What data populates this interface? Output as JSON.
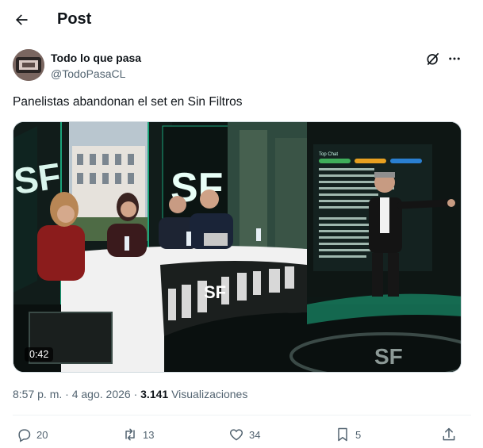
{
  "header": {
    "title": "Post"
  },
  "author": {
    "display_name": "Todo lo que pasa",
    "handle": "@TodoPasaCL"
  },
  "post": {
    "text": "Panelistas abandonan el set en Sin Filtros"
  },
  "video": {
    "duration": "0:42"
  },
  "meta": {
    "time": "8:57 p. m.",
    "separator": "·",
    "date": "4 ago. 2026",
    "views_count": "3.141",
    "views_label": "Visualizaciones"
  },
  "actions": {
    "replies": "20",
    "reposts": "13",
    "likes": "34",
    "bookmarks": "5"
  },
  "icons": {
    "back": "arrow-left-icon",
    "grok": "grok-icon",
    "more": "more-icon",
    "reply": "reply-icon",
    "repost": "repost-icon",
    "like": "heart-icon",
    "bookmark": "bookmark-icon",
    "share": "share-icon"
  },
  "colors": {
    "text": "#0f1419",
    "secondary": "#536471",
    "divider": "#eff3f4",
    "studio_green": "#1aa37a"
  }
}
